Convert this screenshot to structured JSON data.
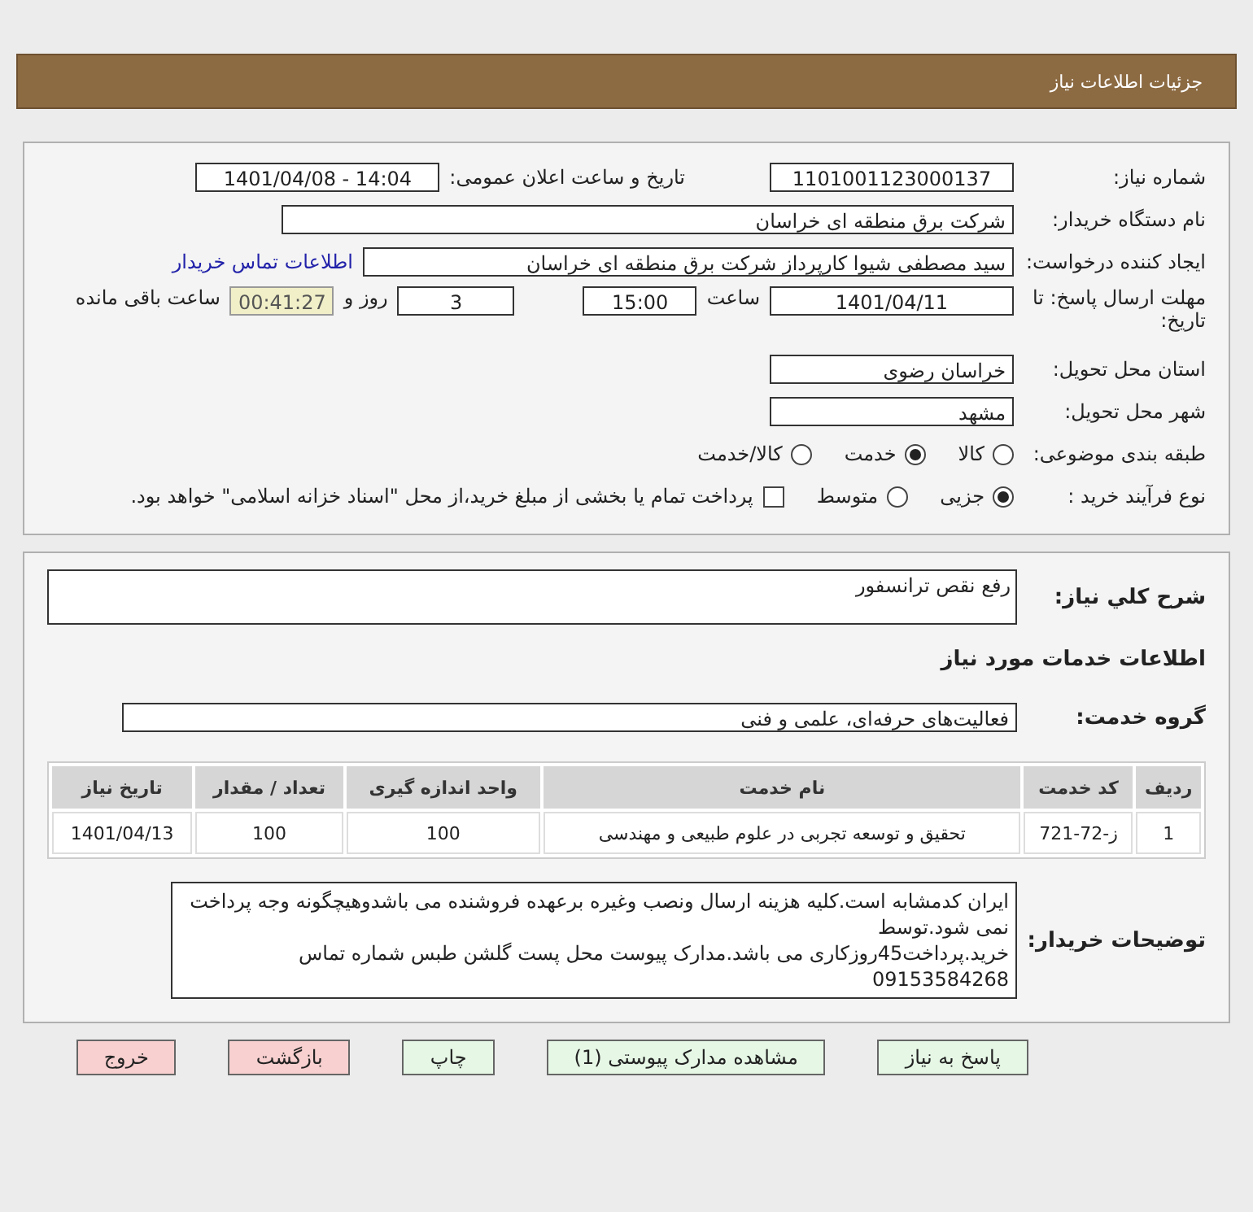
{
  "header": {
    "title": "جزئیات اطلاعات نیاز"
  },
  "need_number": {
    "label": "شماره نیاز:",
    "value": "1101001123000137"
  },
  "announce_datetime": {
    "label": "تاریخ و ساعت اعلان عمومی:",
    "value": "1401/04/08 - 14:04"
  },
  "buyer_org": {
    "label": "نام دستگاه خریدار:",
    "value": "شرکت برق منطقه ای خراسان"
  },
  "requester": {
    "label": "ایجاد کننده درخواست:",
    "value": "سید مصطفی شیوا کارپرداز شرکت برق منطقه ای خراسان",
    "link": "اطلاعات تماس خریدار"
  },
  "deadline": {
    "label": "مهلت ارسال پاسخ: تا تاریخ:",
    "date": "1401/04/11",
    "time_label": "ساعت",
    "time": "15:00",
    "days": "3",
    "days_label": "روز و",
    "remaining": "00:41:27",
    "remaining_label": "ساعت باقی مانده"
  },
  "province": {
    "label": "استان محل تحویل:",
    "value": "خراسان رضوی"
  },
  "city": {
    "label": "شهر محل تحویل:",
    "value": "مشهد"
  },
  "category": {
    "label": "طبقه بندی موضوعی:",
    "options": [
      {
        "label": "کالا",
        "selected": false
      },
      {
        "label": "خدمت",
        "selected": true
      },
      {
        "label": "کالا/خدمت",
        "selected": false
      }
    ]
  },
  "purchase_process": {
    "label": "نوع فرآیند خرید :",
    "options": [
      {
        "label": "جزیی",
        "selected": true
      },
      {
        "label": "متوسط",
        "selected": false
      }
    ],
    "treasury": {
      "checked": false,
      "label": "پرداخت تمام یا بخشی از مبلغ خرید،از محل \"اسناد خزانه اسلامی\" خواهد بود."
    }
  },
  "summary": {
    "label": "شرح کلي نياز:",
    "value": "رفع نقص ترانسفور"
  },
  "services_heading": "اطلاعات خدمات مورد نیاز",
  "service_group": {
    "label": "گروه خدمت:",
    "value": "فعالیت‌های حرفه‌ای، علمی و فنی"
  },
  "table": {
    "columns": [
      "ردیف",
      "کد خدمت",
      "نام خدمت",
      "واحد اندازه گیری",
      "تعداد / مقدار",
      "تاریخ نیاز"
    ],
    "rows": [
      [
        "1",
        "ز-72-721",
        "تحقیق و توسعه تجربی در علوم طبیعی و مهندسی",
        "100",
        "100",
        "1401/04/13"
      ]
    ]
  },
  "buyer_notes": {
    "label": "توضیحات خریدار:",
    "lines": [
      "ایران کدمشابه است.کلیه هزینه ارسال ونصب وغیره برعهده فروشنده می باشدوهیچگونه وجه پرداخت نمی شود.توسط",
      "خرید.پرداخت45روزکاری می باشد.مدارک پیوست محل پست گلشن  طبس شماره تماس 09153584268"
    ]
  },
  "buttons": [
    {
      "label": "پاسخ به نیاز",
      "kind": "primary"
    },
    {
      "label": "مشاهده مدارک پیوستی (1)",
      "kind": "primary"
    },
    {
      "label": "چاپ",
      "kind": "primary"
    },
    {
      "label": "بازگشت",
      "kind": "danger"
    },
    {
      "label": "خروج",
      "kind": "danger"
    }
  ]
}
